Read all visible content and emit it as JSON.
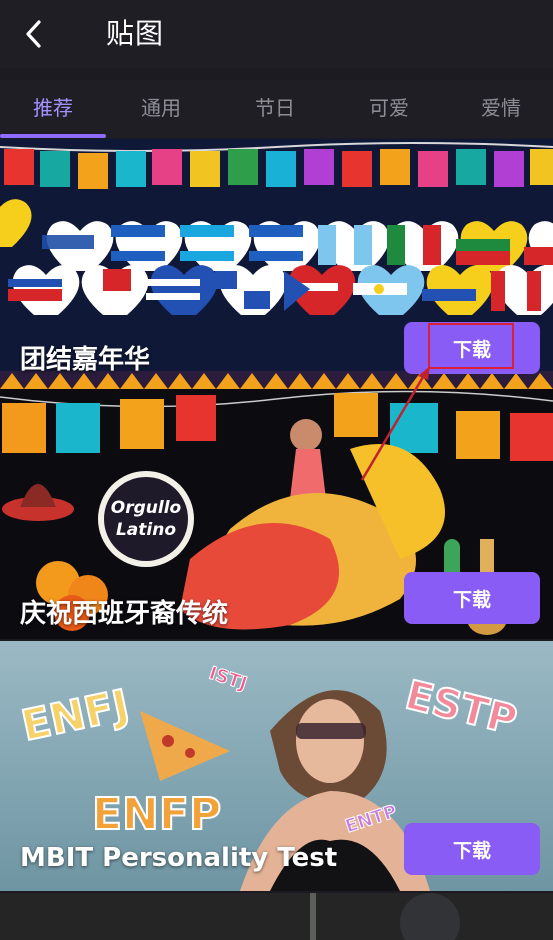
{
  "header": {
    "title": "贴图",
    "back_icon": "chevron-left-icon"
  },
  "tabs": [
    {
      "label": "推荐",
      "active": true
    },
    {
      "label": "通用",
      "active": false
    },
    {
      "label": "节日",
      "active": false
    },
    {
      "label": "可爱",
      "active": false
    },
    {
      "label": "爱情",
      "active": false
    }
  ],
  "cards": [
    {
      "title": "团结嘉年华",
      "button": "下载"
    },
    {
      "title": "庆祝西班牙裔传统",
      "button": "下载",
      "sticker_text": [
        "Orgullo",
        "Latino"
      ]
    },
    {
      "title": "MBIT Personality Test",
      "button": "下载",
      "sticker_text": [
        "ENFJ",
        "ISTJ",
        "ESTP",
        "ENFP",
        "ENTP"
      ]
    }
  ],
  "colors": {
    "accent": "#8a5cf6",
    "tab_active": "#a592ff",
    "highlight": "#d9203a"
  }
}
